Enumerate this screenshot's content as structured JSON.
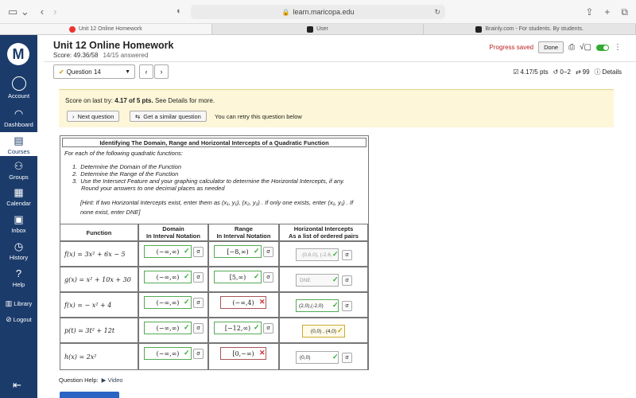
{
  "browser": {
    "url": "learn.maricopa.edu",
    "tabs": [
      "Unit 12 Online Homework",
      "User",
      "Brainly.com - For students. By students."
    ]
  },
  "sidebar": {
    "logo": "M",
    "items": [
      {
        "label": "Account",
        "icon": "avatar-icon"
      },
      {
        "label": "Dashboard",
        "icon": "dashboard-icon"
      },
      {
        "label": "Courses",
        "icon": "courses-icon"
      },
      {
        "label": "Groups",
        "icon": "groups-icon"
      },
      {
        "label": "Calendar",
        "icon": "calendar-icon"
      },
      {
        "label": "Inbox",
        "icon": "inbox-icon"
      },
      {
        "label": "History",
        "icon": "history-icon"
      },
      {
        "label": "Help",
        "icon": "help-icon"
      },
      {
        "label": "Library",
        "icon": "library-icon"
      },
      {
        "label": "Logout",
        "icon": "logout-icon"
      }
    ]
  },
  "header": {
    "title": "Unit 12 Online Homework",
    "score_label": "Score: 49.36/58",
    "answered": "14/15 answered",
    "progress_saved": "Progress saved",
    "done_label": "Done"
  },
  "question_nav": {
    "selected": "Question 14",
    "points": "4.17/5 pts",
    "retries": "0−2",
    "attempts": "99",
    "details": "Details"
  },
  "score_panel": {
    "prefix": "Score on last try: ",
    "score": "4.17 of 5 pts.",
    "suffix": " See Details for more.",
    "next_label": "Next question",
    "similar_label": "Get a similar question",
    "retry_text": "You can retry this question below"
  },
  "problem": {
    "title": "Identifying The Domain, Range and Horizontal Intercepts of a Quadratic Function",
    "intro": "For each of the following quadratic functions:",
    "steps": [
      "Determine the Domain of the Function",
      "Determine the Range of the Function",
      "Use the Intersect Feature and your graphing calculator to determine the Horizontal Intercepts, if any.",
      "Round your answers to one decimal places as needed"
    ],
    "hint": "[Hint: If two Horizontal Intercepts exist, enter them as (x₁, y₁), (x₂, y₂) . If only one exists, enter (x₁, y₁) . If none exist, enter DNE]"
  },
  "table": {
    "headers": {
      "function": "Function",
      "domain": "Domain\nIn Interval Notation",
      "range": "Range\nIn Interval Notation",
      "intercepts": "Horizontal Intercepts\nAs a list of ordered pairs"
    },
    "rows": [
      {
        "fn": "f(x) = 3x² + 6x − 5",
        "domain": "(−∞,∞)",
        "range": "[−8,∞)",
        "intercepts": "(0.6,0), (-2.6,"
      },
      {
        "fn": "g(x) = x² + 10x + 30",
        "domain": "(−∞,∞)",
        "range": "[5,∞)",
        "intercepts": "DNE"
      },
      {
        "fn": "f(x) = − x² + 4",
        "domain": "(−∞,∞)",
        "range": "(−∞,4)",
        "intercepts": "(2,0),(-2,0)"
      },
      {
        "fn": "p(t) = 3t² + 12t",
        "domain": "(−∞,∞)",
        "range": "[−12,∞)",
        "intercepts": "(0,0) , (4,0)"
      },
      {
        "fn": "h(x) = 2x²",
        "domain": "(−∞,∞)",
        "range": "[0,−∞)",
        "intercepts": "(0,0)"
      }
    ]
  },
  "footer": {
    "help_label": "Question Help:",
    "video_label": "Video"
  }
}
